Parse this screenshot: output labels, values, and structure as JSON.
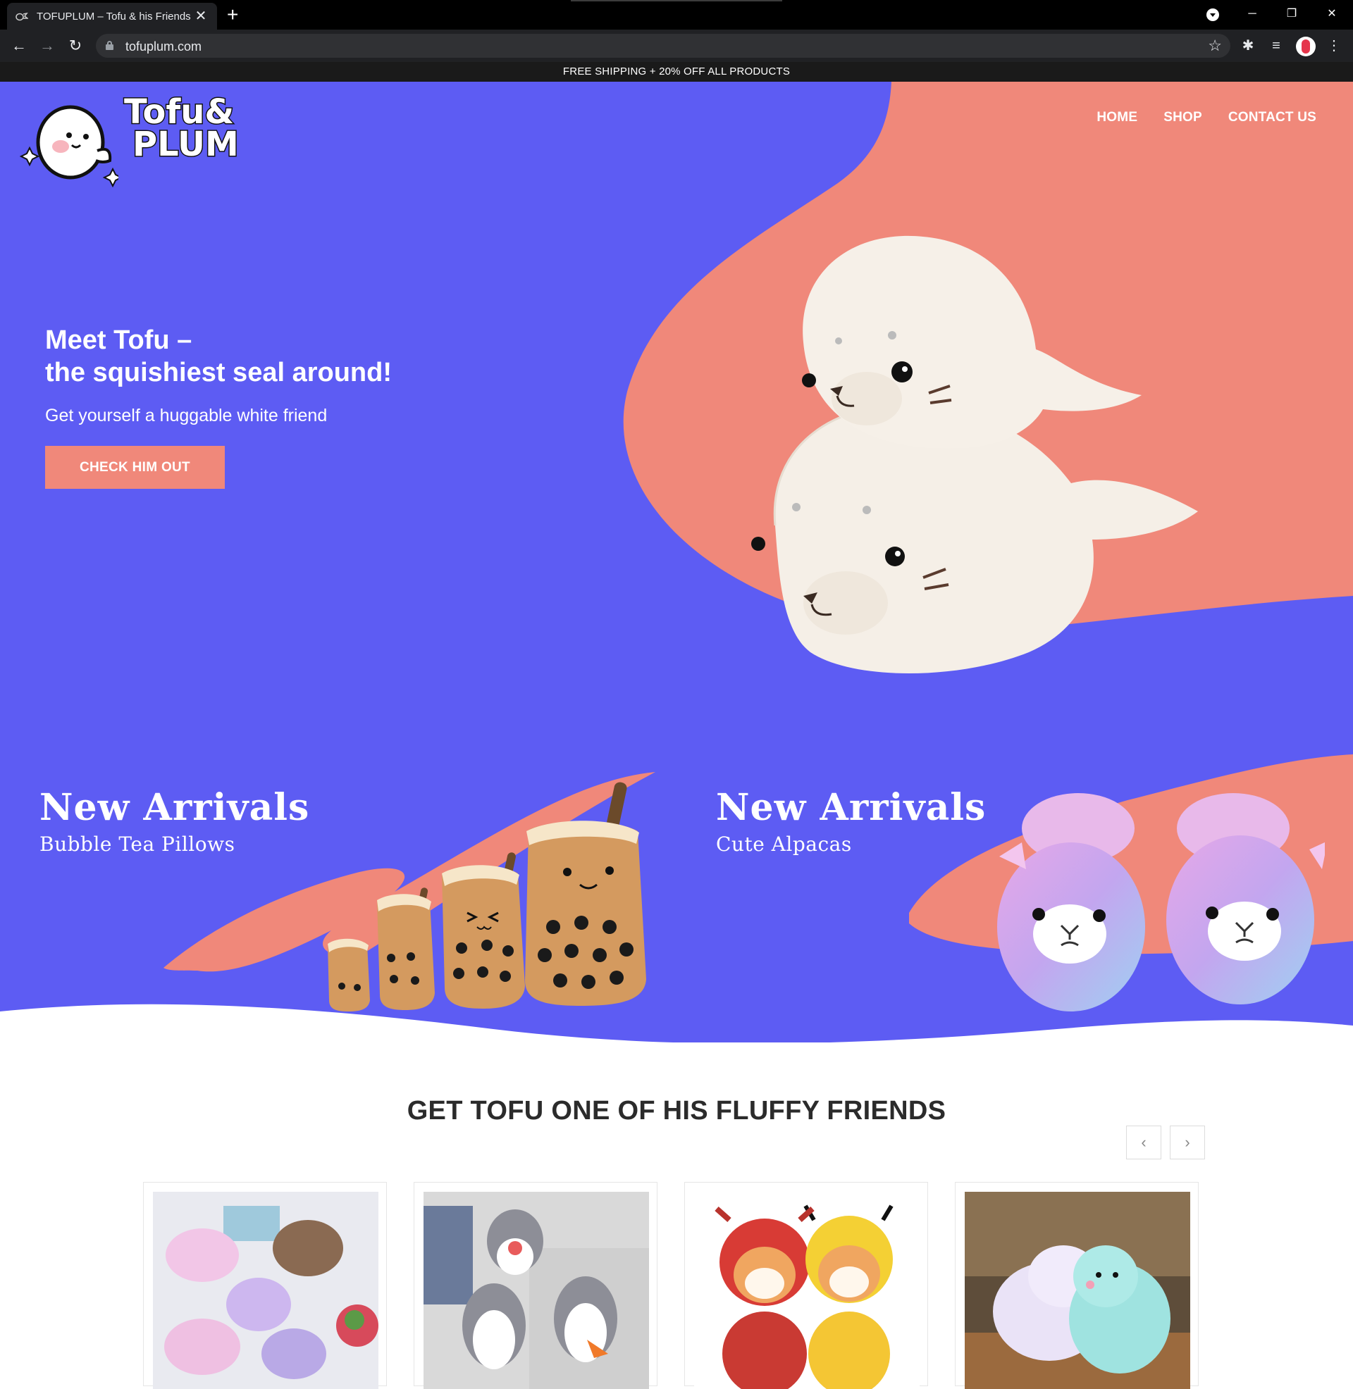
{
  "browser": {
    "tab_title": "TOFUPLUM – Tofu & his Friends",
    "url": "tofuplum.com"
  },
  "announcement": "FREE SHIPPING + 20% OFF ALL PRODUCTS",
  "header": {
    "logo_alt": "Tofu & Plum",
    "nav": {
      "home": "HOME",
      "shop": "SHOP",
      "contact": "CONTACT US"
    }
  },
  "hero": {
    "heading_line1": "Meet Tofu –",
    "heading_line2": "the squishiest seal around!",
    "subheading": "Get yourself a huggable white friend",
    "cta": "CHECK HIM OUT"
  },
  "arrivals": [
    {
      "title": "New Arrivals",
      "subtitle": "Bubble Tea Pillows"
    },
    {
      "title": "New Arrivals",
      "subtitle": "Cute Alpacas"
    }
  ],
  "friends_section": {
    "title": "GET TOFU ONE OF HIS FLUFFY FRIENDS"
  },
  "colors": {
    "brand_purple": "#5d5cf3",
    "brand_coral": "#f0887a",
    "announce_bg": "#1a1a1a"
  },
  "icons": {
    "back": "arrow-left-icon",
    "forward": "arrow-right-icon",
    "reload": "reload-icon",
    "lock": "lock-icon",
    "bookmark": "star-icon",
    "extensions": "puzzle-icon",
    "media": "media-queue-icon",
    "menu": "kebab-menu-icon",
    "carousel_prev": "chevron-left-icon",
    "carousel_next": "chevron-right-icon"
  }
}
